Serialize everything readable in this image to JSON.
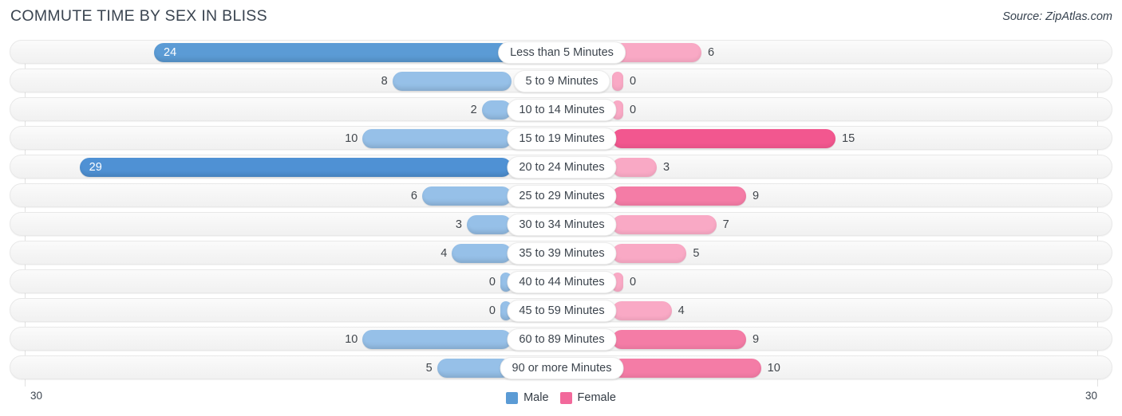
{
  "title": "COMMUTE TIME BY SEX IN BLISS",
  "source": "Source: ZipAtlas.com",
  "legend": {
    "male": {
      "label": "Male",
      "color": "#5b9bd5"
    },
    "female": {
      "label": "Female",
      "color": "#f2699b"
    }
  },
  "axis": {
    "left_max": "30",
    "right_max": "30"
  },
  "chart_data": {
    "type": "bar",
    "title": "COMMUTE TIME BY SEX IN BLISS",
    "orientation": "horizontal-diverging",
    "xlabel": "",
    "ylabel": "",
    "xlim": [
      30,
      30
    ],
    "grid": true,
    "legend_position": "bottom-center",
    "categories": [
      "Less than 5 Minutes",
      "5 to 9 Minutes",
      "10 to 14 Minutes",
      "15 to 19 Minutes",
      "20 to 24 Minutes",
      "25 to 29 Minutes",
      "30 to 34 Minutes",
      "35 to 39 Minutes",
      "40 to 44 Minutes",
      "45 to 59 Minutes",
      "60 to 89 Minutes",
      "90 or more Minutes"
    ],
    "series": [
      {
        "name": "Male",
        "side": "left",
        "color": "#5b9bd5",
        "values": [
          24,
          8,
          2,
          10,
          29,
          6,
          3,
          4,
          0,
          0,
          10,
          5
        ]
      },
      {
        "name": "Female",
        "side": "right",
        "color": "#f2699b",
        "values": [
          6,
          0,
          0,
          15,
          3,
          9,
          7,
          5,
          0,
          4,
          9,
          10
        ]
      }
    ]
  }
}
